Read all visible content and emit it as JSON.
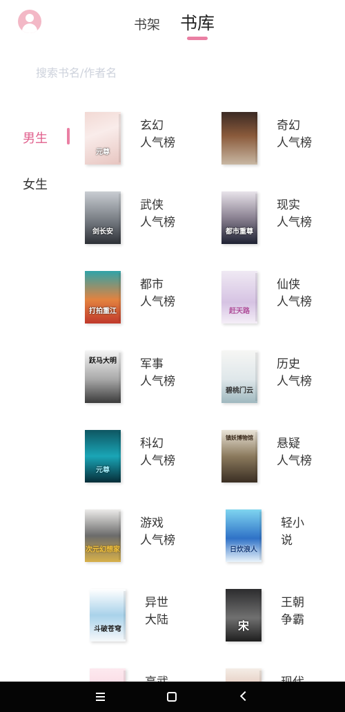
{
  "header": {
    "tabs": [
      {
        "label": "书架"
      },
      {
        "label": "书库"
      }
    ]
  },
  "search": {
    "placeholder": "搜索书名/作者名"
  },
  "sidebar": {
    "items": [
      {
        "label": "男生"
      },
      {
        "label": "女生"
      }
    ]
  },
  "categories": [
    {
      "line1": "玄幻",
      "line2": "人气榜",
      "cover_text": "元尊"
    },
    {
      "line1": "奇幻",
      "line2": "人气榜",
      "cover_text": ""
    },
    {
      "line1": "武侠",
      "line2": "人气榜",
      "cover_text": "剑长安"
    },
    {
      "line1": "现实",
      "line2": "人气榜",
      "cover_text": "都市重尊"
    },
    {
      "line1": "都市",
      "line2": "人气榜",
      "cover_text": "打拍重江"
    },
    {
      "line1": "仙侠",
      "line2": "人气榜",
      "cover_text": "赶天路"
    },
    {
      "line1": "军事",
      "line2": "人气榜",
      "cover_text": "跃马大明"
    },
    {
      "line1": "历史",
      "line2": "人气榜",
      "cover_text": "碧桃门云"
    },
    {
      "line1": "科幻",
      "line2": "人气榜",
      "cover_text": "元尊"
    },
    {
      "line1": "悬疑",
      "line2": "人气榜",
      "cover_text": "镇妖博物馆"
    },
    {
      "line1": "游戏",
      "line2": "人气榜",
      "cover_text": "次元幻想家"
    },
    {
      "line1": "轻小",
      "line2": "说",
      "cover_text": "日炊浪人"
    },
    {
      "line1": "异世",
      "line2": "大陆",
      "cover_text": "斗破苍穹"
    },
    {
      "line1": "王朝",
      "line2": "争霸",
      "cover_text": "宋"
    },
    {
      "line1": "高武",
      "line2": "",
      "cover_text": ""
    },
    {
      "line1": "现代",
      "line2": "",
      "cover_text": ""
    }
  ]
}
